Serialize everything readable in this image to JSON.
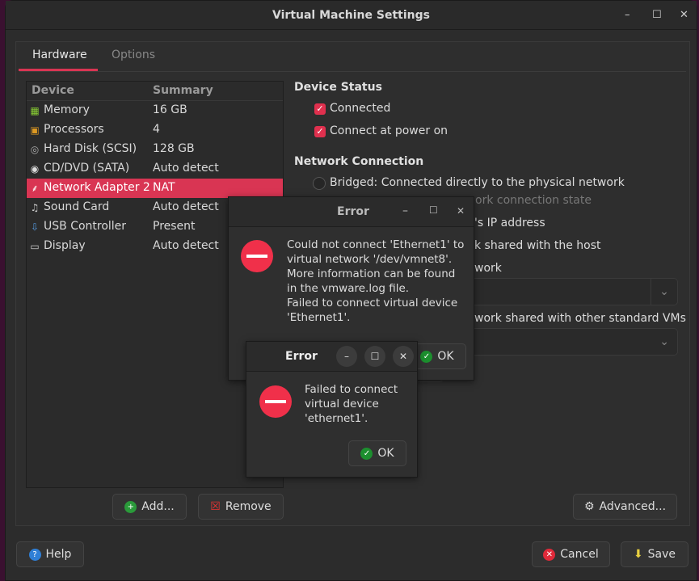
{
  "window": {
    "title": "Virtual Machine Settings",
    "minimize": "–",
    "maximize": "☐",
    "close": "✕"
  },
  "tabs": [
    {
      "label": "Hardware",
      "active": true
    },
    {
      "label": "Options",
      "active": false
    }
  ],
  "device_list": {
    "headers": [
      "Device",
      "Summary"
    ],
    "rows": [
      {
        "device": "Memory",
        "summary": "16 GB",
        "icon": "memory-icon"
      },
      {
        "device": "Processors",
        "summary": "4",
        "icon": "processor-icon"
      },
      {
        "device": "Hard Disk (SCSI)",
        "summary": "128 GB",
        "icon": "hard-disk-icon"
      },
      {
        "device": "CD/DVD (SATA)",
        "summary": "Auto detect",
        "icon": "cd-icon"
      },
      {
        "device": "Network Adapter 2",
        "summary": "NAT",
        "icon": "network-icon",
        "selected": true
      },
      {
        "device": "Sound Card",
        "summary": "Auto detect",
        "icon": "sound-icon"
      },
      {
        "device": "USB Controller",
        "summary": "Present",
        "icon": "usb-icon"
      },
      {
        "device": "Display",
        "summary": "Auto detect",
        "icon": "display-icon"
      }
    ]
  },
  "device_status": {
    "heading": "Device Status",
    "connected": "Connected",
    "connect_power_on": "Connect at power on"
  },
  "network": {
    "heading": "Network Connection",
    "bridged": "Bridged: Connected directly to the physical network",
    "replicate_frag": "ork connection state",
    "nat_frag": "'s IP address",
    "host_only_frag": "k shared with the host",
    "custom_frag": "work",
    "lan_frag": "work shared with other standard VMs"
  },
  "buttons": {
    "add": "Add...",
    "remove": "Remove",
    "advanced": "Advanced...",
    "help": "Help",
    "cancel": "Cancel",
    "save": "Save"
  },
  "error1": {
    "title": "Error",
    "lines": [
      "Could not connect 'Ethernet1' to",
      "virtual network '/dev/vmnet8'.",
      "More information can be found",
      "in the vmware.log file.",
      "Failed to connect virtual device",
      "'Ethernet1'."
    ],
    "ok": "OK"
  },
  "error2": {
    "title": "Error",
    "lines": [
      "Failed to connect",
      "virtual device",
      "'ethernet1'."
    ],
    "ok": "OK"
  },
  "colors": {
    "accent": "#d93553",
    "error": "#f0304a",
    "ok": "#1c8f2e"
  }
}
